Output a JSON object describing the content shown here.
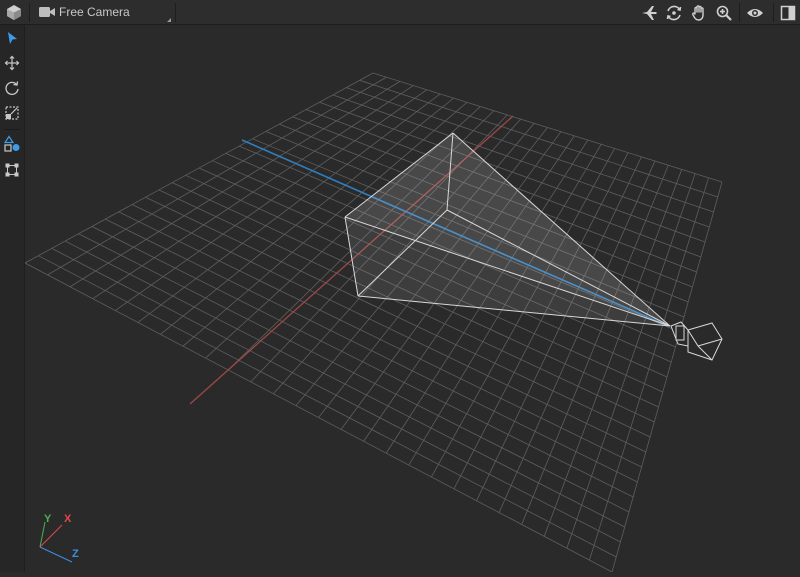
{
  "toolbar": {
    "camera_label": "Free Camera",
    "right_tools": [
      {
        "name": "fly-mode-icon"
      },
      {
        "name": "orbit-icon"
      },
      {
        "name": "pan-hand-icon"
      },
      {
        "name": "zoom-icon"
      },
      {
        "name": "visibility-eye-icon"
      },
      {
        "name": "toggle-panel-icon"
      }
    ]
  },
  "left_tools": [
    {
      "name": "select-arrow-icon",
      "active": true
    },
    {
      "name": "move-icon",
      "active": false
    },
    {
      "name": "rotate-icon",
      "active": false
    },
    {
      "name": "scale-icon",
      "active": false
    },
    {
      "name": "snap-shapes-icon",
      "active": true
    },
    {
      "name": "bounds-icon",
      "active": false
    }
  ],
  "axes": {
    "y": "Y",
    "x": "X",
    "z": "Z"
  },
  "colors": {
    "background": "#2a2a2a",
    "grid": "#5e5e5e",
    "x_axis": "#a04848",
    "z_axis": "#2f7fc0",
    "gizmo_y": "#4caf50",
    "gizmo_x": "#e04848",
    "gizmo_z": "#3d8fe0",
    "accent": "#3d9be9",
    "frustum_line": "#d8d8d8"
  }
}
